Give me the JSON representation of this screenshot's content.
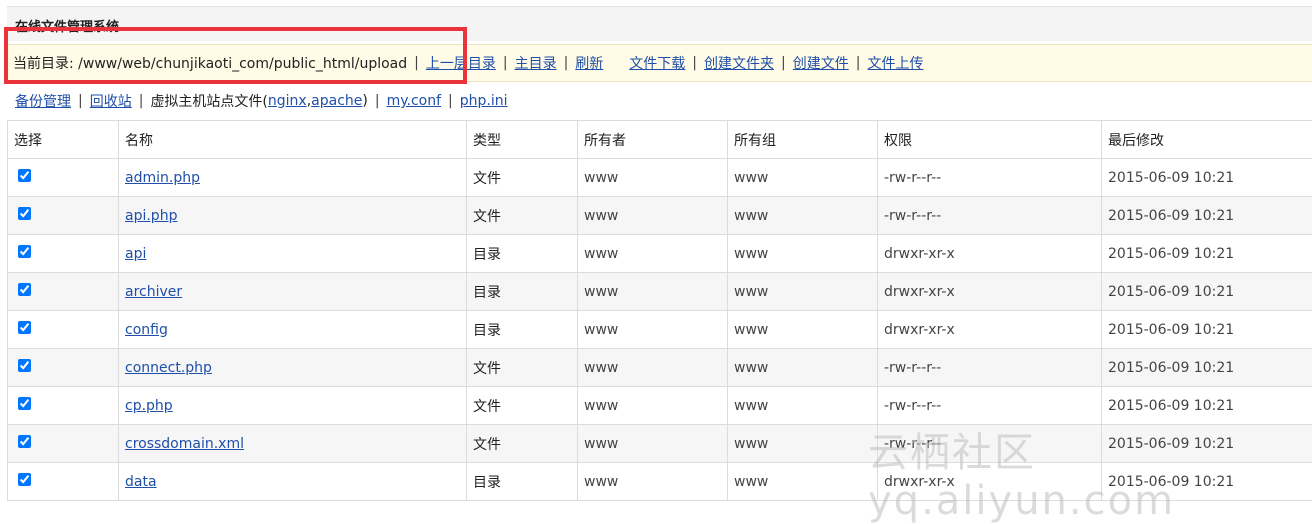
{
  "app": {
    "title": "在线文件管理系统"
  },
  "path_bar": {
    "current_label": "当前目录: /www/web/chunjikaoti_com/public_html/upload",
    "links": {
      "parent": "上一层目录",
      "home": "主目录",
      "refresh": "刷新",
      "download": "文件下载",
      "new_folder": "创建文件夹",
      "new_file": "创建文件",
      "upload": "文件上传"
    }
  },
  "secondary_bar": {
    "backup": "备份管理",
    "recycle": "回收站",
    "vhost_prefix": "虚拟主机站点文件(",
    "nginx": "nginx",
    "comma": ",",
    "apache": "apache",
    "vhost_suffix": ")",
    "my_conf": "my.conf",
    "php_ini": "php.ini",
    "separator": "|"
  },
  "table": {
    "headers": {
      "select": "选择",
      "name": "名称",
      "type": "类型",
      "owner": "所有者",
      "group": "所有组",
      "permissions": "权限",
      "modified": "最后修改"
    },
    "rows": [
      {
        "name": "admin.php",
        "type": "文件",
        "owner": "www",
        "group": "www",
        "permissions": "-rw-r--r--",
        "modified": "2015-06-09 10:21",
        "checked": true
      },
      {
        "name": "api.php",
        "type": "文件",
        "owner": "www",
        "group": "www",
        "permissions": "-rw-r--r--",
        "modified": "2015-06-09 10:21",
        "checked": true
      },
      {
        "name": "api",
        "type": "目录",
        "owner": "www",
        "group": "www",
        "permissions": "drwxr-xr-x",
        "modified": "2015-06-09 10:21",
        "checked": true
      },
      {
        "name": "archiver",
        "type": "目录",
        "owner": "www",
        "group": "www",
        "permissions": "drwxr-xr-x",
        "modified": "2015-06-09 10:21",
        "checked": true
      },
      {
        "name": "config",
        "type": "目录",
        "owner": "www",
        "group": "www",
        "permissions": "drwxr-xr-x",
        "modified": "2015-06-09 10:21",
        "checked": true
      },
      {
        "name": "connect.php",
        "type": "文件",
        "owner": "www",
        "group": "www",
        "permissions": "-rw-r--r--",
        "modified": "2015-06-09 10:21",
        "checked": true
      },
      {
        "name": "cp.php",
        "type": "文件",
        "owner": "www",
        "group": "www",
        "permissions": "-rw-r--r--",
        "modified": "2015-06-09 10:21",
        "checked": true
      },
      {
        "name": "crossdomain.xml",
        "type": "文件",
        "owner": "www",
        "group": "www",
        "permissions": "-rw-r--r--",
        "modified": "2015-06-09 10:21",
        "checked": true
      },
      {
        "name": "data",
        "type": "目录",
        "owner": "www",
        "group": "www",
        "permissions": "drwxr-xr-x",
        "modified": "2015-06-09 10:21",
        "checked": true
      }
    ]
  },
  "watermark": "云栖社区 yq.aliyun.com"
}
